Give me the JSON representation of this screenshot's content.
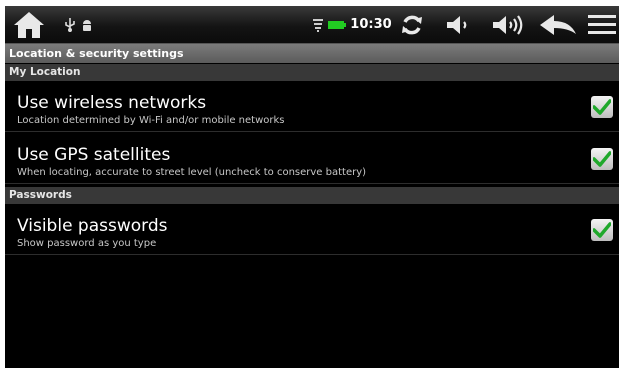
{
  "status_bar": {
    "time": "10:30",
    "icons": [
      "home-icon",
      "usb-icon",
      "android-icon",
      "wifi-icon",
      "battery-icon",
      "sync-icon",
      "volume-down-icon",
      "volume-up-icon",
      "back-icon",
      "menu-icon"
    ],
    "battery_color": "#22cc22"
  },
  "title": "Location & security settings",
  "sections": [
    {
      "header": "My Location",
      "items": [
        {
          "title": "Use wireless networks",
          "summary": "Location determined by Wi-Fi and/or mobile networks",
          "checked": true
        },
        {
          "title": "Use GPS satellites",
          "summary": "When locating, accurate to street level (uncheck to conserve battery)",
          "checked": true
        }
      ]
    },
    {
      "header": "Passwords",
      "items": [
        {
          "title": "Visible passwords",
          "summary": "Show password as you type",
          "checked": true
        }
      ]
    }
  ],
  "colors": {
    "check": "#1fa82b",
    "background": "#000000",
    "header_bg": "#383838"
  }
}
